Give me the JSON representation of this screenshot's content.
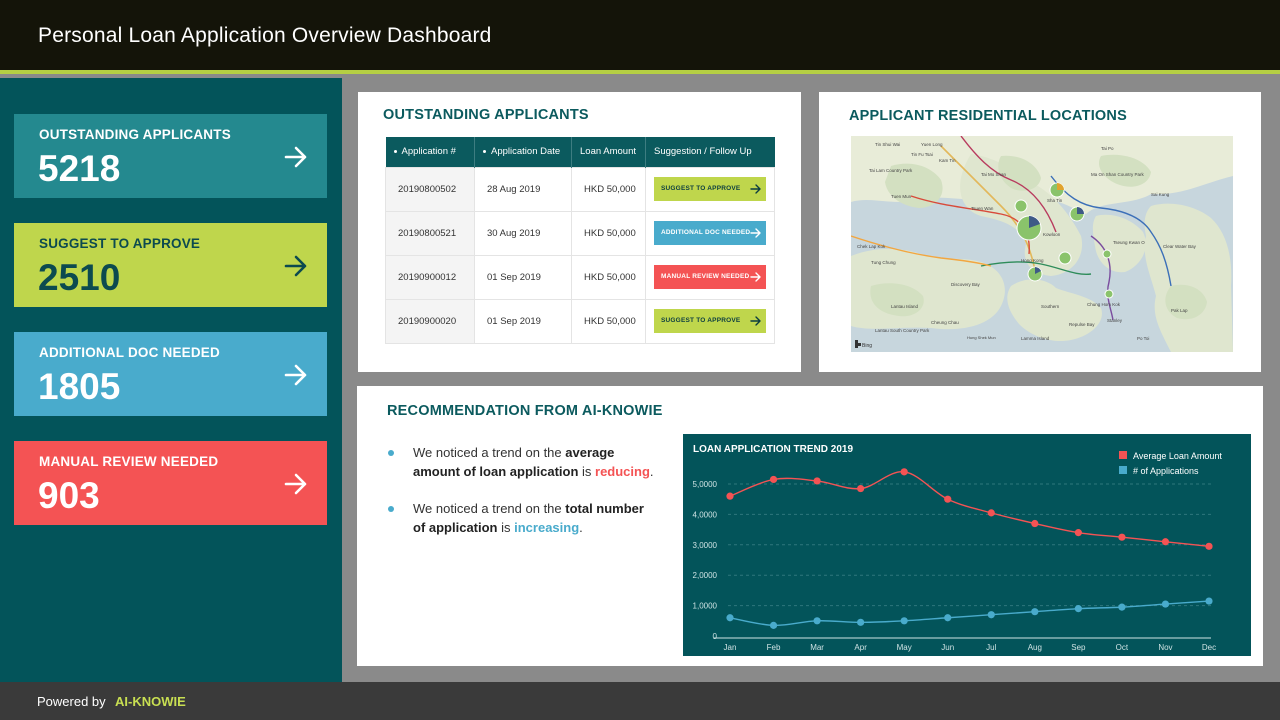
{
  "header": {
    "title": "Personal Loan Application Overview Dashboard"
  },
  "kpis": [
    {
      "label": "OUTSTANDING APPLICANTS",
      "value": "5218"
    },
    {
      "label": "SUGGEST TO APPROVE",
      "value": "2510"
    },
    {
      "label": "ADDITIONAL DOC NEEDED",
      "value": "1805"
    },
    {
      "label": "MANUAL REVIEW NEEDED",
      "value": "903"
    }
  ],
  "applicants": {
    "title": "OUTSTANDING APPLICANTS",
    "columns": [
      "Application #",
      "Application Date",
      "Loan Amount",
      "Suggestion / Follow Up"
    ],
    "rows": [
      {
        "id": "20190800502",
        "date": "28 Aug 2019",
        "amount": "HKD 50,000",
        "action": "SUGGEST TO APPROVE"
      },
      {
        "id": "20190800521",
        "date": "30 Aug 2019",
        "amount": "HKD 50,000",
        "action": "ADDITIONAL DOC NEEDED"
      },
      {
        "id": "20190900012",
        "date": "01 Sep 2019",
        "amount": "HKD 50,000",
        "action": "MANUAL REVIEW NEEDED"
      },
      {
        "id": "20190900020",
        "date": "01 Sep 2019",
        "amount": "HKD 50,000",
        "action": "SUGGEST TO APPROVE"
      }
    ]
  },
  "map": {
    "title": "APPLICANT RESIDENTIAL LOCATIONS",
    "places": [
      "Tin Shui Wai",
      "Yuen Long",
      "Tai Po",
      "Tai Lam Country Park",
      "Tuen Mun",
      "Sha Tin",
      "Tsuen Wan",
      "Kowloon",
      "Tseung Kwan O",
      "Hong Kong",
      "Tung Chung",
      "Lantau Island",
      "Lamma Island",
      "Ma On Shan Country Park",
      "Sai Kung",
      "Clear Water Bay",
      "Chek Lap Kok",
      "Discovery Bay",
      "Southern",
      "Repulse Bay",
      "Chung Hom Kok",
      "Stanley",
      "Lantau South Country Park",
      "Cheung Chau",
      "Po Toi",
      "Hung Shek Mun",
      "Pak Lap",
      "Tai Mo Shan",
      "Kam Tin",
      "Tin Fu Tsai"
    ],
    "attribution": "Bing"
  },
  "recommendation": {
    "title": "RECOMMENDATION FROM AI-KNOWIE",
    "b1_pre": "We noticed a trend on the ",
    "b1_bold": "average amount of loan application",
    "b1_mid": " is ",
    "b1_hl": "reducing",
    "b1_end": ".",
    "b2_pre": "We noticed a trend on the ",
    "b2_bold": "total number of application",
    "b2_mid": " is ",
    "b2_hl": "increasing",
    "b2_end": "."
  },
  "footer": {
    "powered": "Powered by",
    "brand": "AI-KNOWIE"
  },
  "colors": {
    "teal": "#03545a",
    "lime": "#bfd64c",
    "blue": "#49abcc",
    "red": "#f45354",
    "header": "#141409"
  },
  "chart_data": {
    "type": "line",
    "title": "LOAN APPLICATION TREND 2019",
    "categories": [
      "Jan",
      "Feb",
      "Mar",
      "Apr",
      "May",
      "Jun",
      "Jul",
      "Aug",
      "Sep",
      "Oct",
      "Nov",
      "Dec"
    ],
    "series": [
      {
        "name": "Average Loan Amount",
        "color": "#f45354",
        "values": [
          4600,
          5150,
          5100,
          4850,
          5400,
          4500,
          4050,
          3700,
          3400,
          3250,
          3100,
          2950
        ]
      },
      {
        "name": "# of Applications",
        "color": "#49abcc",
        "values": [
          600,
          350,
          500,
          450,
          500,
          600,
          700,
          800,
          900,
          950,
          1050,
          1150
        ]
      }
    ],
    "yticks": [
      "0",
      "1,0000",
      "2,0000",
      "3,0000",
      "4,0000",
      "5,0000"
    ],
    "ylim": [
      0,
      5000
    ],
    "legend": "top-right",
    "grid": true
  }
}
